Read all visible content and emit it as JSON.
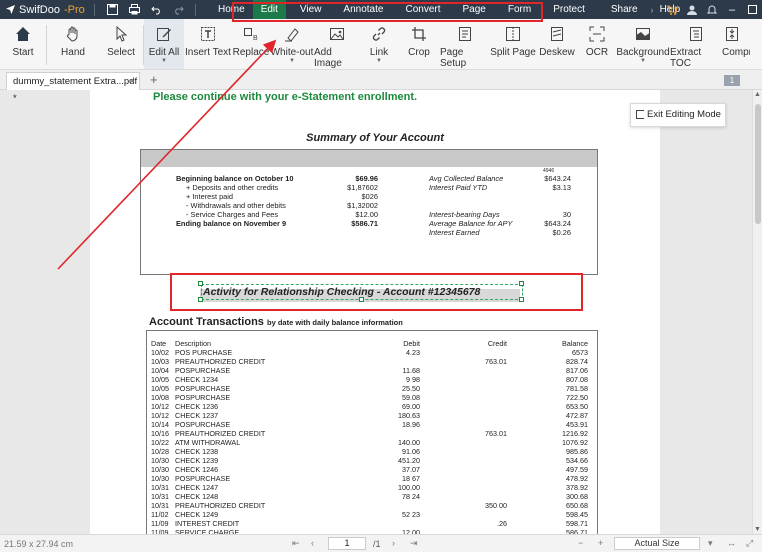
{
  "app": {
    "name": "SwifDoo",
    "suffix": "-Pro"
  },
  "menu": {
    "items": [
      "Home",
      "Edit",
      "View",
      "Annotate",
      "Convert",
      "Page",
      "Form",
      "Protect",
      "Share",
      "Help"
    ],
    "active": "Edit"
  },
  "toolbar": {
    "tools": [
      {
        "label": "Start",
        "icon": "home-icon"
      },
      {
        "label": "Hand",
        "icon": "hand-icon"
      },
      {
        "label": "Select",
        "icon": "cursor-icon"
      },
      {
        "label": "Edit All",
        "icon": "edit-icon"
      },
      {
        "label": "Insert Text",
        "icon": "insert-text-icon"
      },
      {
        "label": "Replace",
        "icon": "replace-icon"
      },
      {
        "label": "White-out",
        "icon": "eraser-icon"
      },
      {
        "label": "Add Image",
        "icon": "image-icon"
      },
      {
        "label": "Link",
        "icon": "link-icon"
      },
      {
        "label": "Crop",
        "icon": "crop-icon"
      },
      {
        "label": "Page Setup",
        "icon": "page-setup-icon"
      },
      {
        "label": "Split Page",
        "icon": "split-icon"
      },
      {
        "label": "Deskew",
        "icon": "deskew-icon"
      },
      {
        "label": "OCR",
        "icon": "ocr-icon"
      },
      {
        "label": "Background",
        "icon": "background-icon"
      },
      {
        "label": "Extract TOC",
        "icon": "toc-icon"
      },
      {
        "label": "Compr",
        "icon": "compress-icon"
      }
    ]
  },
  "tabs": {
    "document": "dummy_statement Extra...pdf *",
    "page_badge": "1"
  },
  "document": {
    "enroll_text": "Please continue with your e-Statement enrollment.",
    "summary_title": "Summary of Your Account",
    "summary_tiny": "4946",
    "summary_left": [
      {
        "label": "Beginning balance on October 10",
        "value": "$69.96",
        "bold": true
      },
      {
        "label": "+ Deposits and other credits",
        "value": "$1,87602",
        "bold": false
      },
      {
        "label": "+ Interest paid",
        "value": "$026",
        "bold": false
      },
      {
        "label": "- Withdrawals and other debits",
        "value": "$1,32002",
        "bold": false
      },
      {
        "label": "- Service Charges and Fees",
        "value": "$12.00",
        "bold": false
      },
      {
        "label": "Ending balance on November 9",
        "value": "$586.71",
        "bold": true
      }
    ],
    "summary_right": [
      {
        "label": "Avg Collected Balance",
        "value": "$643.24"
      },
      {
        "label": "Interest Paid YTD",
        "value": "$3.13"
      },
      {
        "label": "",
        "value": ""
      },
      {
        "label": "",
        "value": ""
      },
      {
        "label": "Interest-bearing Days",
        "value": "30"
      },
      {
        "label": "Average Balance for APY",
        "value": "$643.24"
      },
      {
        "label": "Interest Earned",
        "value": "$0.26"
      }
    ],
    "activity_title": "Activity for Relationship Checking - Account #12345678",
    "transactions_title": "Account Transactions",
    "transactions_sub": "by date with daily balance information",
    "columns": [
      "Date",
      "Description",
      "Debit",
      "Credit",
      "Balance"
    ],
    "rows": [
      [
        "10/02",
        "POS PURCHASE",
        "4.23",
        "",
        "6573"
      ],
      [
        "10/03",
        "PREAUTHORIZED CREDIT",
        "",
        "763.01",
        "828.74"
      ],
      [
        "10/04",
        "POSPURCHASE",
        "11.68",
        "",
        "817.06"
      ],
      [
        "10/05",
        "CHECK 1234",
        "9 98",
        "",
        "807.08"
      ],
      [
        "10/05",
        "POSPURCHASE",
        "25.50",
        "",
        "781.58"
      ],
      [
        "10/08",
        "POSPURCHASE",
        "59.08",
        "",
        "722.50"
      ],
      [
        "10/12",
        "CHECK 1236",
        "69.00",
        "",
        "653.50"
      ],
      [
        "10/12",
        "CHECK 1237",
        "180.63",
        "",
        "472.87"
      ],
      [
        "10/14",
        "POSPURCHASE",
        "18.96",
        "",
        "453.91"
      ],
      [
        "10/16",
        "PREAUTHORIZED CREDIT",
        "",
        "763.01",
        "1216.92"
      ],
      [
        "10/22",
        "ATM WITHDRAWAL",
        "140.00",
        "",
        "1076.92"
      ],
      [
        "10/28",
        "CHECK 1238",
        "91.06",
        "",
        "985.86"
      ],
      [
        "10/30",
        "CHECK 1239",
        "451.20",
        "",
        "534.66"
      ],
      [
        "10/30",
        "CHECK 1246",
        "37.07",
        "",
        "497.59"
      ],
      [
        "10/30",
        "POSPURCHASE",
        "18 67",
        "",
        "478.92"
      ],
      [
        "10/31",
        "CHECK 1247",
        "100.00",
        "",
        "378.92"
      ],
      [
        "10/31",
        "CHECK 1248",
        "78 24",
        "",
        "300.68"
      ],
      [
        "10/31",
        "PREAUTHORIZED CREDIT",
        "",
        "350 00",
        "650.68"
      ],
      [
        "11/02",
        "CHECK 1249",
        "52 23",
        "",
        "598.45"
      ],
      [
        "11/09",
        "INTEREST CREDIT",
        "",
        ".26",
        "598.71"
      ],
      [
        "11/09",
        "SERVICE CHARGE",
        "12.00",
        "",
        "586.71"
      ]
    ]
  },
  "exit_button": "Exit Editing Mode",
  "status": {
    "dimensions": "21.59 x 27.94 cm",
    "page": "1",
    "total": "/1",
    "zoom": "Actual Size"
  },
  "colors": {
    "menubar": "#2d3a4a",
    "active_menu": "#1c7a4a",
    "enroll_green": "#1c8a3c",
    "annotation_red": "#e0252b"
  }
}
